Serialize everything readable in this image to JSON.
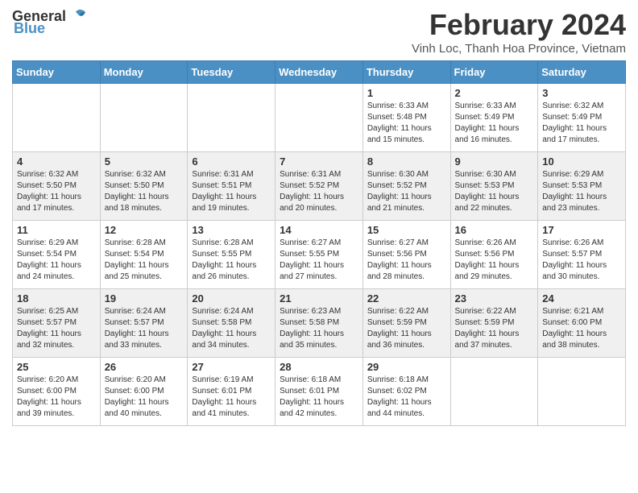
{
  "header": {
    "logo_general": "General",
    "logo_blue": "Blue",
    "title": "February 2024",
    "subtitle": "Vinh Loc, Thanh Hoa Province, Vietnam"
  },
  "days_of_week": [
    "Sunday",
    "Monday",
    "Tuesday",
    "Wednesday",
    "Thursday",
    "Friday",
    "Saturday"
  ],
  "weeks": [
    [
      {
        "day": "",
        "info": ""
      },
      {
        "day": "",
        "info": ""
      },
      {
        "day": "",
        "info": ""
      },
      {
        "day": "",
        "info": ""
      },
      {
        "day": "1",
        "info": "Sunrise: 6:33 AM\nSunset: 5:48 PM\nDaylight: 11 hours and 15 minutes."
      },
      {
        "day": "2",
        "info": "Sunrise: 6:33 AM\nSunset: 5:49 PM\nDaylight: 11 hours and 16 minutes."
      },
      {
        "day": "3",
        "info": "Sunrise: 6:32 AM\nSunset: 5:49 PM\nDaylight: 11 hours and 17 minutes."
      }
    ],
    [
      {
        "day": "4",
        "info": "Sunrise: 6:32 AM\nSunset: 5:50 PM\nDaylight: 11 hours and 17 minutes."
      },
      {
        "day": "5",
        "info": "Sunrise: 6:32 AM\nSunset: 5:50 PM\nDaylight: 11 hours and 18 minutes."
      },
      {
        "day": "6",
        "info": "Sunrise: 6:31 AM\nSunset: 5:51 PM\nDaylight: 11 hours and 19 minutes."
      },
      {
        "day": "7",
        "info": "Sunrise: 6:31 AM\nSunset: 5:52 PM\nDaylight: 11 hours and 20 minutes."
      },
      {
        "day": "8",
        "info": "Sunrise: 6:30 AM\nSunset: 5:52 PM\nDaylight: 11 hours and 21 minutes."
      },
      {
        "day": "9",
        "info": "Sunrise: 6:30 AM\nSunset: 5:53 PM\nDaylight: 11 hours and 22 minutes."
      },
      {
        "day": "10",
        "info": "Sunrise: 6:29 AM\nSunset: 5:53 PM\nDaylight: 11 hours and 23 minutes."
      }
    ],
    [
      {
        "day": "11",
        "info": "Sunrise: 6:29 AM\nSunset: 5:54 PM\nDaylight: 11 hours and 24 minutes."
      },
      {
        "day": "12",
        "info": "Sunrise: 6:28 AM\nSunset: 5:54 PM\nDaylight: 11 hours and 25 minutes."
      },
      {
        "day": "13",
        "info": "Sunrise: 6:28 AM\nSunset: 5:55 PM\nDaylight: 11 hours and 26 minutes."
      },
      {
        "day": "14",
        "info": "Sunrise: 6:27 AM\nSunset: 5:55 PM\nDaylight: 11 hours and 27 minutes."
      },
      {
        "day": "15",
        "info": "Sunrise: 6:27 AM\nSunset: 5:56 PM\nDaylight: 11 hours and 28 minutes."
      },
      {
        "day": "16",
        "info": "Sunrise: 6:26 AM\nSunset: 5:56 PM\nDaylight: 11 hours and 29 minutes."
      },
      {
        "day": "17",
        "info": "Sunrise: 6:26 AM\nSunset: 5:57 PM\nDaylight: 11 hours and 30 minutes."
      }
    ],
    [
      {
        "day": "18",
        "info": "Sunrise: 6:25 AM\nSunset: 5:57 PM\nDaylight: 11 hours and 32 minutes."
      },
      {
        "day": "19",
        "info": "Sunrise: 6:24 AM\nSunset: 5:57 PM\nDaylight: 11 hours and 33 minutes."
      },
      {
        "day": "20",
        "info": "Sunrise: 6:24 AM\nSunset: 5:58 PM\nDaylight: 11 hours and 34 minutes."
      },
      {
        "day": "21",
        "info": "Sunrise: 6:23 AM\nSunset: 5:58 PM\nDaylight: 11 hours and 35 minutes."
      },
      {
        "day": "22",
        "info": "Sunrise: 6:22 AM\nSunset: 5:59 PM\nDaylight: 11 hours and 36 minutes."
      },
      {
        "day": "23",
        "info": "Sunrise: 6:22 AM\nSunset: 5:59 PM\nDaylight: 11 hours and 37 minutes."
      },
      {
        "day": "24",
        "info": "Sunrise: 6:21 AM\nSunset: 6:00 PM\nDaylight: 11 hours and 38 minutes."
      }
    ],
    [
      {
        "day": "25",
        "info": "Sunrise: 6:20 AM\nSunset: 6:00 PM\nDaylight: 11 hours and 39 minutes."
      },
      {
        "day": "26",
        "info": "Sunrise: 6:20 AM\nSunset: 6:00 PM\nDaylight: 11 hours and 40 minutes."
      },
      {
        "day": "27",
        "info": "Sunrise: 6:19 AM\nSunset: 6:01 PM\nDaylight: 11 hours and 41 minutes."
      },
      {
        "day": "28",
        "info": "Sunrise: 6:18 AM\nSunset: 6:01 PM\nDaylight: 11 hours and 42 minutes."
      },
      {
        "day": "29",
        "info": "Sunrise: 6:18 AM\nSunset: 6:02 PM\nDaylight: 11 hours and 44 minutes."
      },
      {
        "day": "",
        "info": ""
      },
      {
        "day": "",
        "info": ""
      }
    ]
  ]
}
